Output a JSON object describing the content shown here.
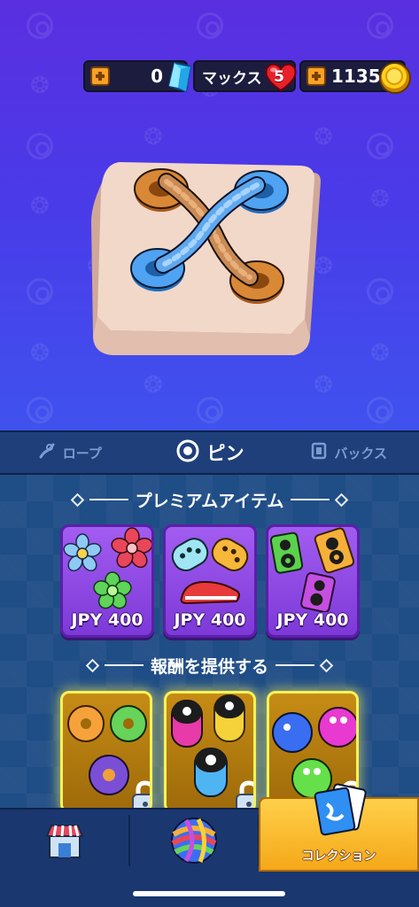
{
  "currency": {
    "gems": "0",
    "lives_label": "マックス",
    "lives_count": "5",
    "coins": "1135"
  },
  "tabs": [
    {
      "label": "ロープ",
      "icon": "rope-icon",
      "active": false
    },
    {
      "label": "ピン",
      "icon": "pin-icon",
      "active": true
    },
    {
      "label": "バックス",
      "icon": "box-icon",
      "active": false
    }
  ],
  "premium": {
    "title": "プレミアムアイテム",
    "items": [
      {
        "price": "JPY 400",
        "icon": "flower-pins-icon"
      },
      {
        "price": "JPY 400",
        "icon": "shoe-pins-icon"
      },
      {
        "price": "JPY 400",
        "icon": "speaker-pins-icon"
      }
    ]
  },
  "rewards": {
    "title": "報酬を提供する",
    "items": [
      {
        "icon": "donut-pins-icon",
        "locked": true
      },
      {
        "icon": "capsule-pins-icon",
        "locked": true
      },
      {
        "icon": "ball-pins-icon",
        "locked": true
      }
    ]
  },
  "nav": {
    "shop_icon": "shop-icon",
    "play_icon": "yarn-ball-icon",
    "collection_label": "コレクション",
    "collection_icon": "collection-cards-icon"
  },
  "colors": {
    "bg_top": "#5a2fe0",
    "bg_bottom": "#3f52ee",
    "card_purple": "#8a45e0",
    "card_gold": "#c68c15",
    "nav_active": "#f5a819"
  }
}
